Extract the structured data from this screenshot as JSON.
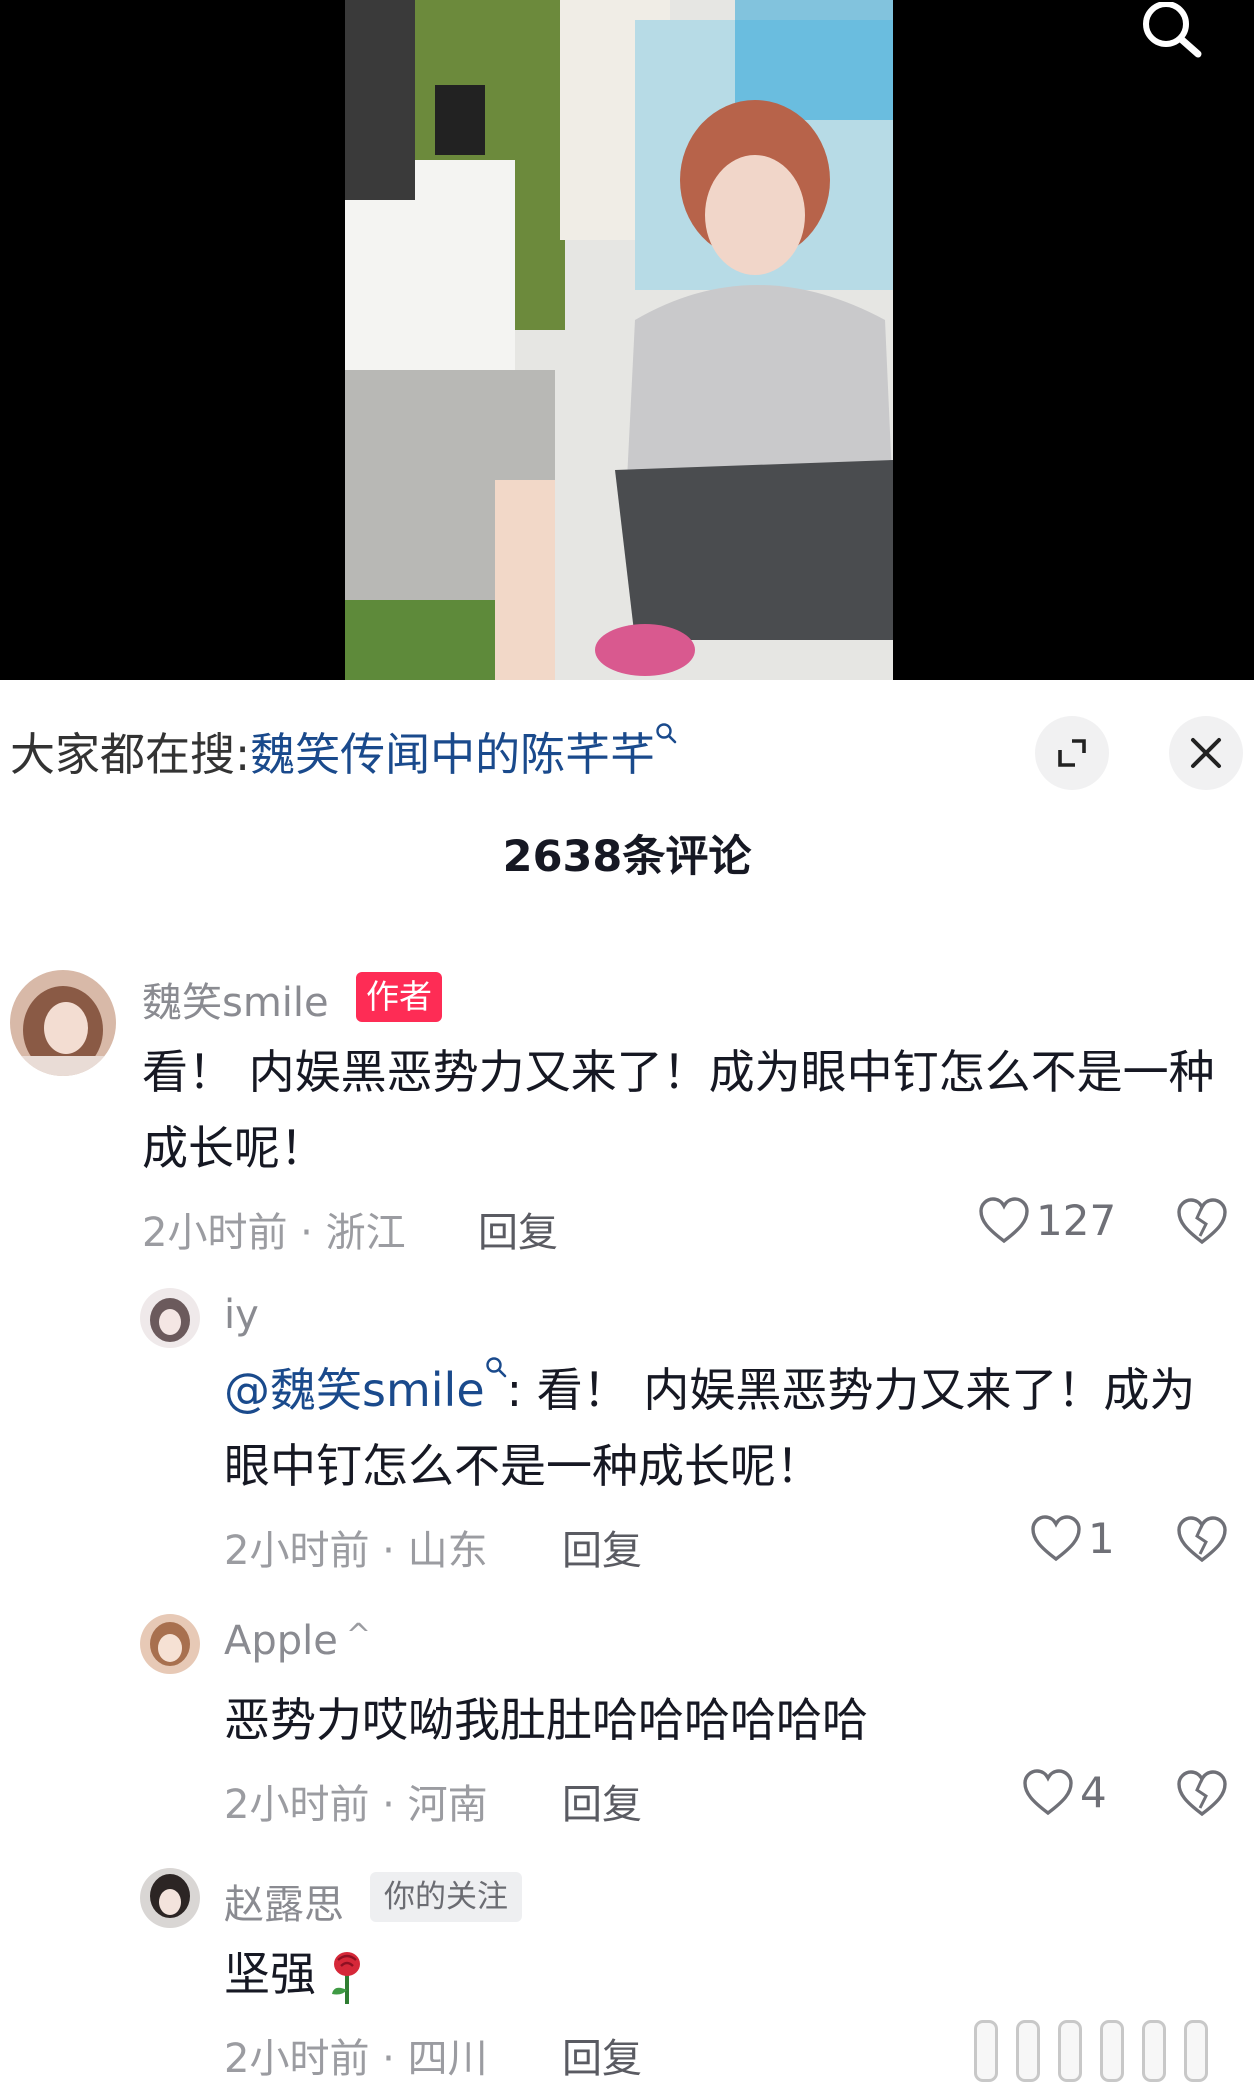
{
  "search": {
    "prefix": "大家都在搜:",
    "query": "魏笑传闻中的陈芊芊"
  },
  "comments_header": {
    "count_label": "2638条评论"
  },
  "comments": [
    {
      "username": "魏笑smile",
      "badge": "作者",
      "text": "看！ 内娱黑恶势力又来了！成为眼中钉怎么不是一种成长呢！",
      "meta": "2小时前 · 浙江",
      "reply_label": "回复",
      "likes": "127"
    },
    {
      "username": "iy",
      "mention": "@魏笑smile",
      "text": ": 看！ 内娱黑恶势力又来了！成为眼中钉怎么不是一种成长呢！",
      "meta": "2小时前 · 山东",
      "reply_label": "回复",
      "likes": "1"
    },
    {
      "username": "Apple",
      "text": "恶势力哎呦我肚肚哈哈哈哈哈哈",
      "meta": "2小时前 · 河南",
      "reply_label": "回复",
      "likes": "4"
    },
    {
      "username": "赵露思",
      "badge": "你的关注",
      "text": "坚强",
      "meta": "2小时前 · 四川",
      "reply_label": "回复"
    }
  ],
  "colors": {
    "accent": "#fe2c55",
    "link": "#1a4a8c",
    "text": "#161823",
    "muted": "#9b9ca1"
  },
  "icons": [
    "search-icon",
    "expand-icon",
    "close-icon",
    "heart-icon",
    "broken-heart-icon",
    "rose-emoji-icon"
  ]
}
